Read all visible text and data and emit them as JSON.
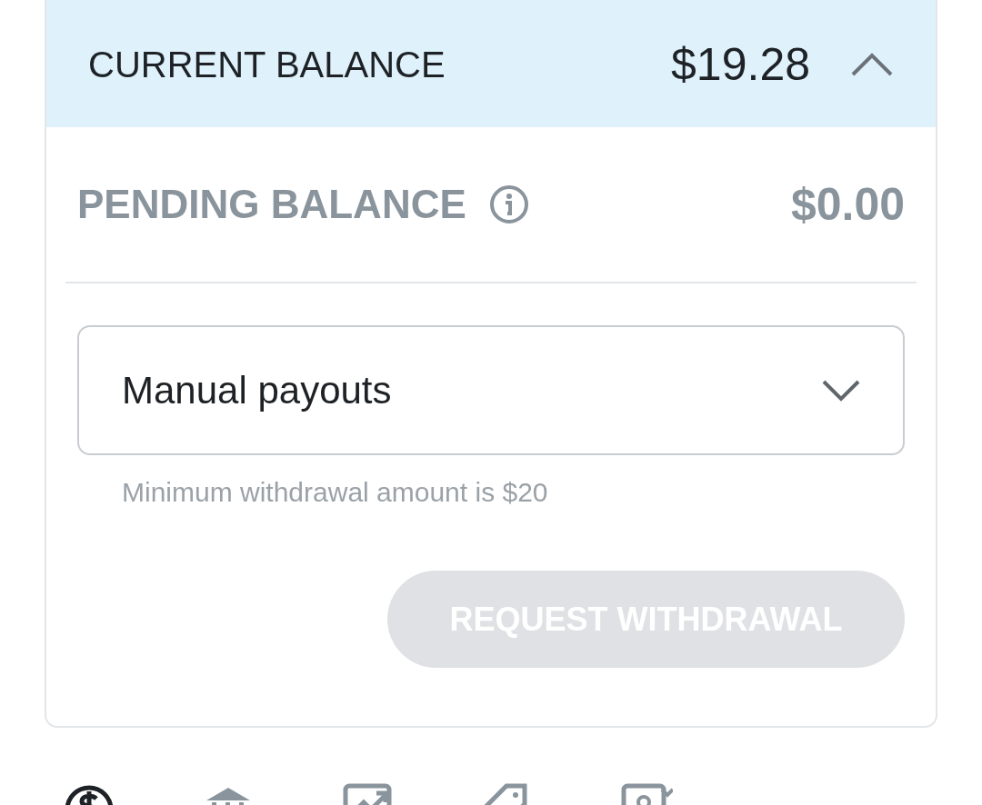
{
  "current_balance": {
    "label": "CURRENT BALANCE",
    "amount": "$19.28",
    "expanded": true
  },
  "pending_balance": {
    "label": "PENDING BALANCE",
    "amount": "$0.00"
  },
  "payout_select": {
    "value": "Manual payouts"
  },
  "helper_text": "Minimum withdrawal amount is $20",
  "withdraw_button": {
    "label": "REQUEST WITHDRAWAL",
    "disabled": true
  },
  "bottom_nav": [
    {
      "kind": "dollar",
      "selected": true
    },
    {
      "kind": "bank",
      "selected": false
    },
    {
      "kind": "chart",
      "selected": false
    },
    {
      "kind": "tag",
      "selected": false
    },
    {
      "kind": "card",
      "selected": false
    }
  ]
}
